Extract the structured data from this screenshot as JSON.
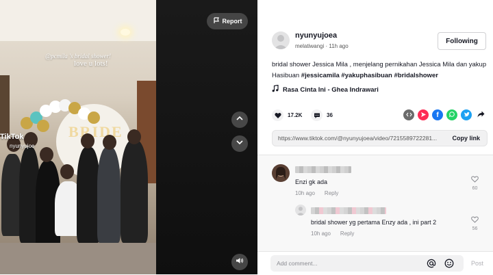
{
  "video": {
    "overlay_line1": "@pcmila 's bridal shower!",
    "overlay_line2": "love u lots!",
    "watermark_brand": "TikTok",
    "watermark_user": "nyunyujoe",
    "arch_text": "BRIDE",
    "report_label": "Report"
  },
  "post": {
    "username": "nyunyujoea",
    "nickname": "melatiwangi",
    "separator": " · ",
    "time": "11h ago",
    "follow_label": "Following",
    "description_plain": "bridal shower Jessica Mila , menjelang pernikahan Jessica Mila dan yakup Hasibuan ",
    "hashtags": [
      "#jessicamila",
      "#yakuphasibuan",
      "#bridalshower"
    ],
    "music": "Rasa Cinta Ini - Ghea Indrawari",
    "likes": "17.2K",
    "comments": "36",
    "link_url": "https://www.tiktok.com/@nyunyujoea/video/7215589722281...",
    "copy_label": "Copy link"
  },
  "comments": [
    {
      "text": "Enzi gk ada",
      "time": "10h ago",
      "reply_label": "Reply",
      "likes": "60"
    },
    {
      "text": "bridal shower yg pertama Enzy ada , ini part 2",
      "time": "10h ago",
      "reply_label": "Reply",
      "likes": "56"
    }
  ],
  "composer": {
    "placeholder": "Add comment...",
    "post_label": "Post"
  },
  "colors": {
    "accent": "#fe2c55",
    "embed": "#6b6b6b",
    "facebook": "#1877f2",
    "whatsapp": "#25d366",
    "twitter": "#1da1f2"
  }
}
